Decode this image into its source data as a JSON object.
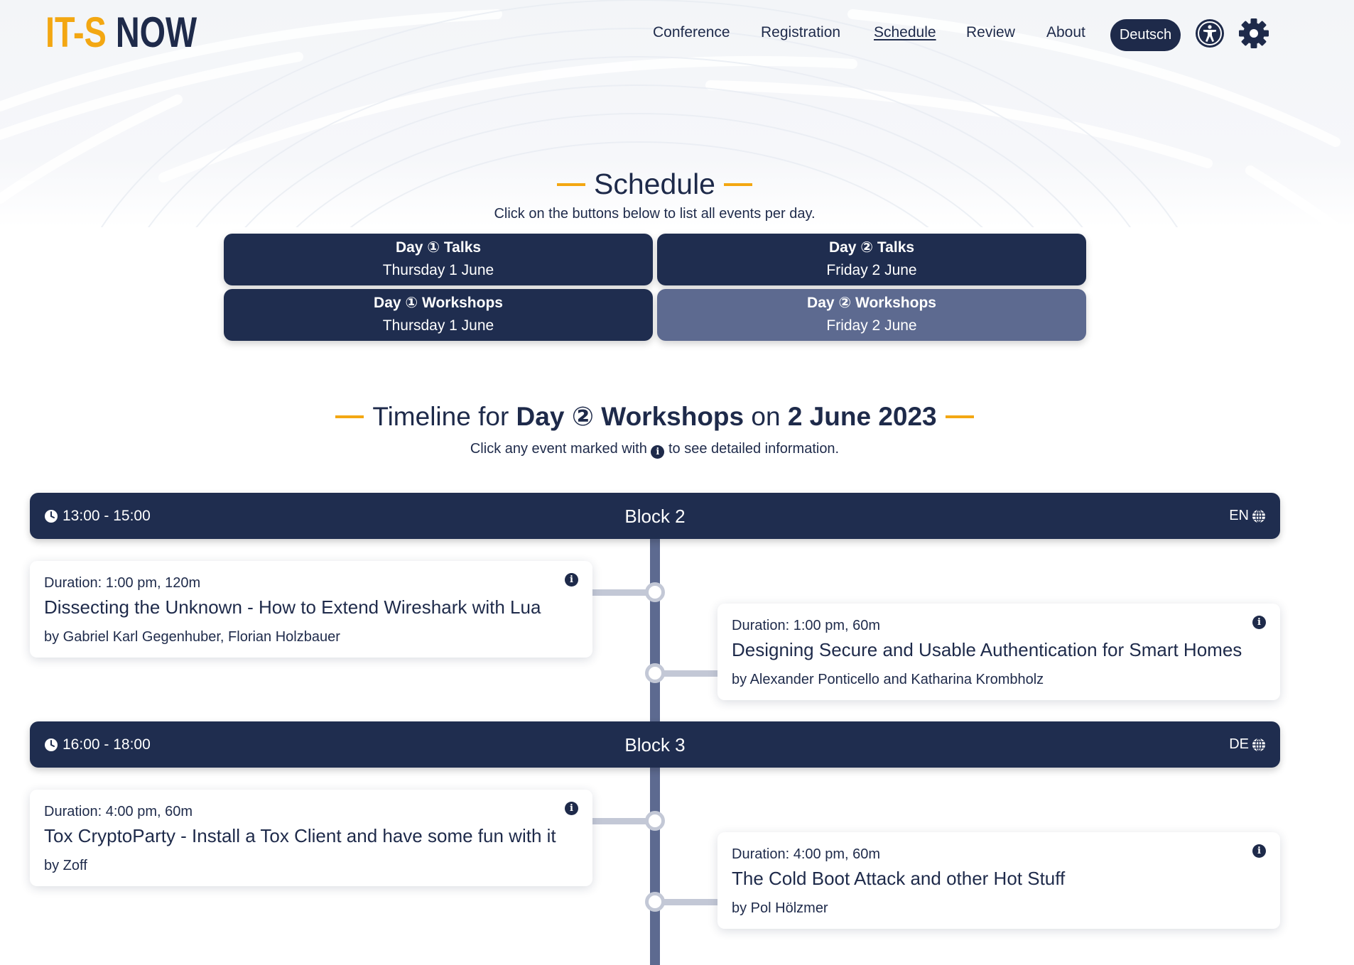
{
  "header": {
    "logo_part1": "IT-S",
    "logo_part2": "NOW",
    "nav": [
      "Conference",
      "Registration",
      "Schedule",
      "Review",
      "About"
    ],
    "active_nav": "Schedule",
    "language_button": "Deutsch",
    "accessibility_icon": "accessibility-icon",
    "settings_icon": "gear-icon"
  },
  "schedule": {
    "title": "Schedule",
    "subtitle": "Click on the buttons below to list all events per day.",
    "days": [
      {
        "label": "Day ① Talks",
        "date": "Thursday 1 June",
        "selected": false
      },
      {
        "label": "Day ② Talks",
        "date": "Friday 2 June",
        "selected": false
      },
      {
        "label": "Day ① Workshops",
        "date": "Thursday 1 June",
        "selected": false
      },
      {
        "label": "Day ② Workshops",
        "date": "Friday 2 June",
        "selected": true
      }
    ]
  },
  "timeline": {
    "title_prefix": "Timeline for",
    "title_day": "Day ② Workshops",
    "title_on": "on",
    "title_date": "2 June 2023",
    "subtitle_before": "Click any event marked with",
    "subtitle_after": "to see detailed information.",
    "info_glyph": "i",
    "blocks": [
      {
        "time": "13:00 - 15:00",
        "name": "Block 2",
        "lang": "EN",
        "events": [
          {
            "duration": "Duration: 1:00 pm, 120m",
            "title": "Dissecting the Unknown - How to Extend Wireshark with Lua",
            "by": "by Gabriel Karl Gegenhuber, Florian Holzbauer"
          },
          {
            "duration": "Duration: 1:00 pm, 60m",
            "title": "Designing Secure and Usable Authentication for Smart Homes",
            "by": "by Alexander Ponticello and Katharina Krombholz"
          }
        ]
      },
      {
        "time": "16:00 - 18:00",
        "name": "Block 3",
        "lang": "DE",
        "events": [
          {
            "duration": "Duration: 4:00 pm, 60m",
            "title": "Tox CryptoParty - Install a Tox Client and have some fun with it",
            "by": "by Zoff"
          },
          {
            "duration": "Duration: 4:00 pm, 60m",
            "title": "The Cold Boot Attack and other Hot Stuff",
            "by": "by Pol Hölzmer"
          }
        ]
      }
    ]
  },
  "colors": {
    "navy": "#1f2d4f",
    "accent": "#f3a712",
    "selected": "#5d6a90",
    "connector": "#c3c8d6"
  }
}
